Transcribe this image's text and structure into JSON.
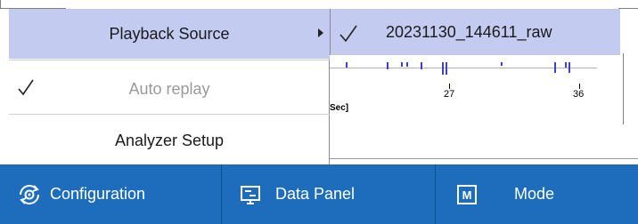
{
  "context_menu": {
    "items": [
      {
        "label": "Playback Source",
        "checked": false,
        "disabled": false,
        "has_submenu": true,
        "highlighted": true
      },
      {
        "label": "Auto replay",
        "checked": true,
        "disabled": true,
        "has_submenu": false,
        "highlighted": false
      },
      {
        "label": "Analyzer Setup",
        "checked": false,
        "disabled": false,
        "has_submenu": false,
        "highlighted": false
      }
    ]
  },
  "submenu": {
    "items": [
      {
        "label": "20231130_144611_raw",
        "checked": true
      }
    ]
  },
  "background_chart": {
    "axis_ticks": [
      "27",
      "36"
    ],
    "axis_unit": "Sec]"
  },
  "toolbar": {
    "configuration_label": "Configuration",
    "data_panel_label": "Data Panel",
    "mode_label": "Mode",
    "mode_icon_letter": "M"
  },
  "colors": {
    "toolbar_blue": "#1e6dbd",
    "menu_highlight": "#c3ccf0",
    "disabled_text": "#9a9a9a"
  },
  "icons": {
    "configuration": "gear-cycle-icon",
    "data_panel": "monitor-icon",
    "mode": "m-square-icon",
    "check": "checkmark-icon",
    "submenu": "submenu-arrow-icon"
  }
}
